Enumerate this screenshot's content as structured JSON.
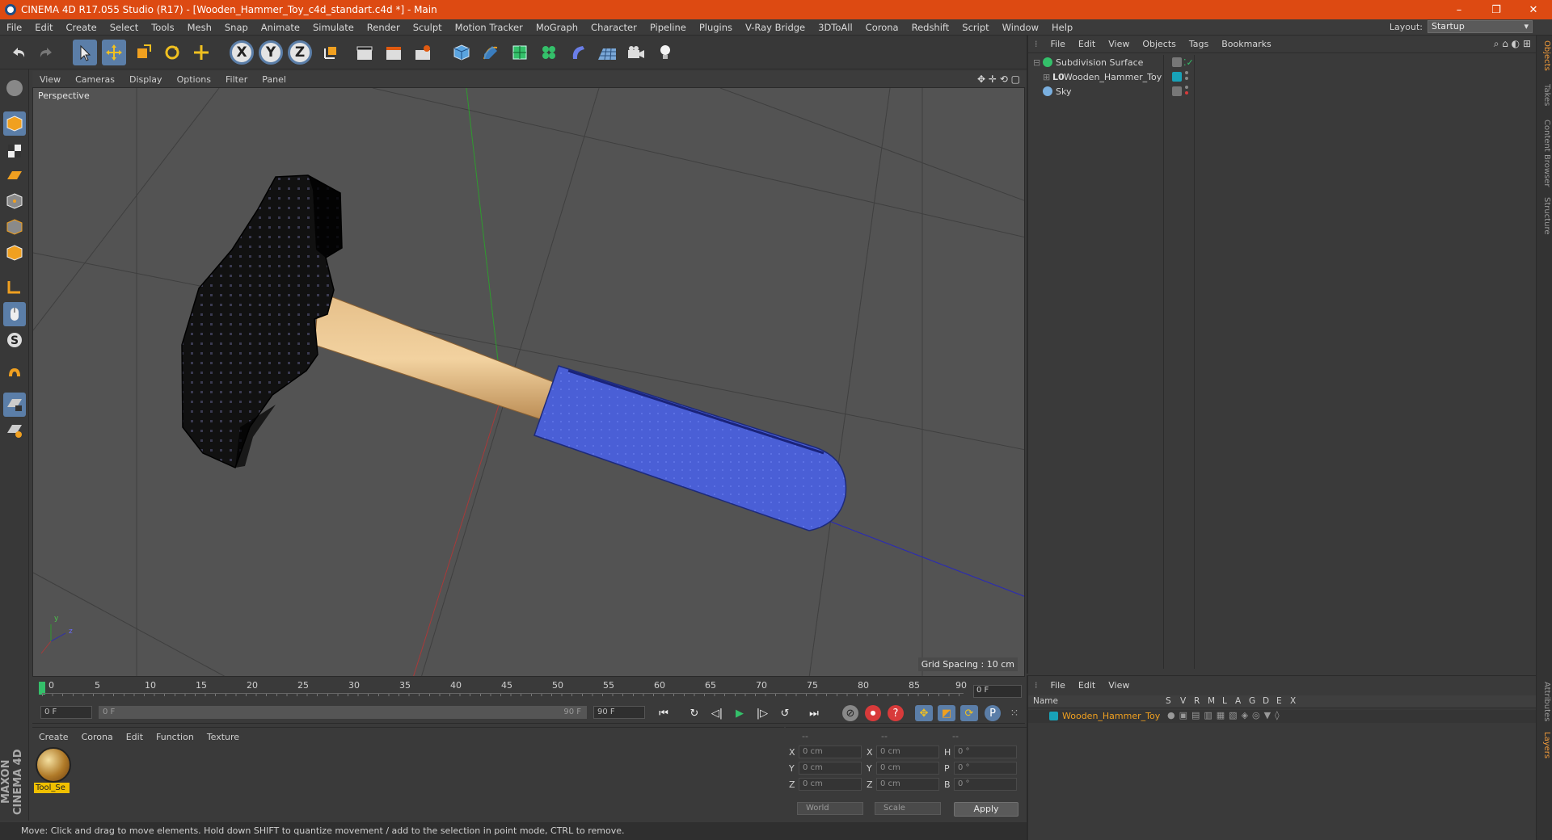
{
  "window": {
    "title": "CINEMA 4D R17.055 Studio (R17) - [Wooden_Hammer_Toy_c4d_standart.c4d *] - Main",
    "minimize": "–",
    "restore": "❐",
    "close": "✕"
  },
  "menubar": {
    "items": [
      "File",
      "Edit",
      "Create",
      "Select",
      "Tools",
      "Mesh",
      "Snap",
      "Animate",
      "Simulate",
      "Render",
      "Sculpt",
      "Motion Tracker",
      "MoGraph",
      "Character",
      "Pipeline",
      "Plugins",
      "V-Ray Bridge",
      "3DToAll",
      "Corona",
      "Redshift",
      "Script",
      "Window",
      "Help"
    ],
    "layout_label": "Layout:",
    "layout_value": "Startup"
  },
  "toolbar": {
    "axis_x": "X",
    "axis_y": "Y",
    "axis_z": "Z"
  },
  "viewport": {
    "menu": [
      "View",
      "Cameras",
      "Display",
      "Options",
      "Filter",
      "Panel"
    ],
    "label": "Perspective",
    "grid_spacing": "Grid Spacing : 10 cm",
    "axis_y": "y",
    "axis_z": "z"
  },
  "timeline": {
    "ticks": [
      "0",
      "5",
      "10",
      "15",
      "20",
      "25",
      "30",
      "35",
      "40",
      "45",
      "50",
      "55",
      "60",
      "65",
      "70",
      "75",
      "80",
      "85",
      "90"
    ],
    "current_frame": "0 F",
    "start_field": "0 F",
    "range_start": "0 F",
    "range_end": "90 F",
    "end_field": "90 F"
  },
  "materials": {
    "menu": [
      "Create",
      "Corona",
      "Edit",
      "Function",
      "Texture"
    ],
    "item_name": "Tool_Se"
  },
  "coordinates": {
    "headers": [
      "--",
      "--",
      "--"
    ],
    "rows": [
      {
        "l1": "X",
        "v1": "0 cm",
        "l2": "X",
        "v2": "0 cm",
        "l3": "H",
        "v3": "0 °"
      },
      {
        "l1": "Y",
        "v1": "0 cm",
        "l2": "Y",
        "v2": "0 cm",
        "l3": "P",
        "v3": "0 °"
      },
      {
        "l1": "Z",
        "v1": "0 cm",
        "l2": "Z",
        "v2": "0 cm",
        "l3": "B",
        "v3": "0 °"
      }
    ],
    "world": "World",
    "scale": "Scale",
    "apply": "Apply"
  },
  "status": "Move: Click and drag to move elements. Hold down SHIFT to quantize movement / add to the selection in point mode, CTRL to remove.",
  "brand": "MAXON CINEMA 4D",
  "objects": {
    "menu": [
      "File",
      "Edit",
      "View",
      "Objects",
      "Tags",
      "Bookmarks"
    ],
    "items": [
      {
        "name": "Subdivision Surface"
      },
      {
        "name": "Wooden_Hammer_Toy"
      },
      {
        "name": "Sky"
      }
    ]
  },
  "layers": {
    "menu": [
      "File",
      "Edit",
      "View"
    ],
    "header_name": "Name",
    "columns": [
      "S",
      "V",
      "R",
      "M",
      "L",
      "A",
      "G",
      "D",
      "E",
      "X"
    ],
    "row_name": "Wooden_Hammer_Toy"
  },
  "right_tabs": [
    "Objects",
    "Takes",
    "Content Browser",
    "Structure",
    "Attributes",
    "Layers"
  ],
  "colors": {
    "title_bar": "#dd4a12",
    "selection_blue": "#5b7ea8",
    "handle_blue": "#4a5fd6",
    "layer_color": "#18a2b8",
    "layer_name": "#f0a020"
  }
}
